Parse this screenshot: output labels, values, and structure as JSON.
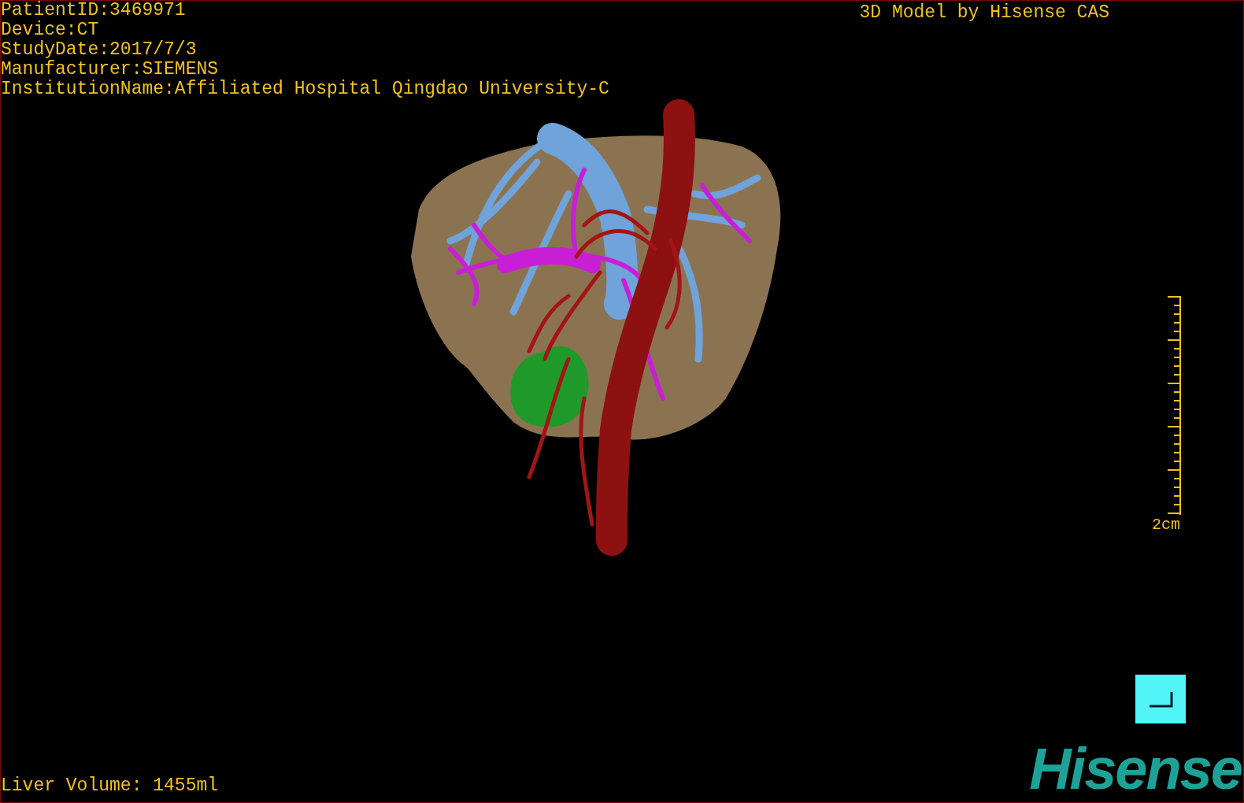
{
  "info_lines": [
    "PatientID:3469971",
    "Device:CT",
    "StudyDate:2017/7/3",
    "Manufacturer:SIEMENS",
    "InstitutionName:Affiliated Hospital Qingdao University-C"
  ],
  "title": "3D Model by Hisense CAS",
  "scale_bar": {
    "label": "2cm"
  },
  "liver_volume": "Liver Volume: 1455ml",
  "logo": "Hisense"
}
